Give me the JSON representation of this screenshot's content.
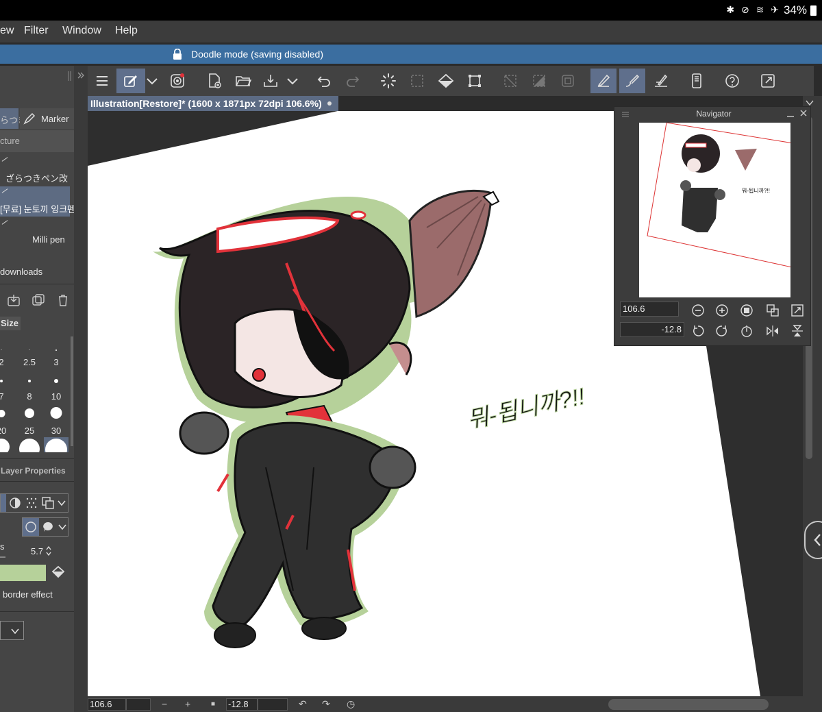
{
  "status_bar": {
    "icons": "✱ ⊘ ≋ ✈",
    "battery": "34%"
  },
  "menu": {
    "items": [
      "ew",
      "Filter",
      "Window",
      "Help"
    ]
  },
  "doodle": {
    "text": "Doodle mode (saving disabled)"
  },
  "document": {
    "tab_title": "Illustration[Restore]* (1600 x 1871px 72dpi 106.6%)"
  },
  "left_panel": {
    "tabs": {
      "partial": "らつき",
      "marker": "Marker",
      "texture": "cture"
    },
    "brushes": [
      "ざらつきペン改",
      "[무료] 눈토끼 잉크펜",
      "Milli pen"
    ],
    "downloads": "downloads",
    "size_title": "Size",
    "sizes": [
      "2",
      "2.5",
      "3",
      "7",
      "8",
      "10",
      "20",
      "25",
      "30"
    ],
    "layer_properties": "Layer Properties",
    "value_label": "s",
    "value": "5.7",
    "border_effect": "border effect",
    "accent_color": "#b6d19a"
  },
  "navigator": {
    "title": "Navigator",
    "zoom": "106.6",
    "rotation": "-12.8",
    "overlay_text": "뭐-됩니까?!!"
  },
  "canvas": {
    "handwriting": "뭐-됩니까?!!"
  },
  "bottom_bar": {
    "zoom": "106.6",
    "rotation": "-12.8"
  },
  "colors": {
    "doodle_bar": "#3b6ea0",
    "active_tool": "#5f6f8c",
    "outline_green": "#b6d19a"
  }
}
